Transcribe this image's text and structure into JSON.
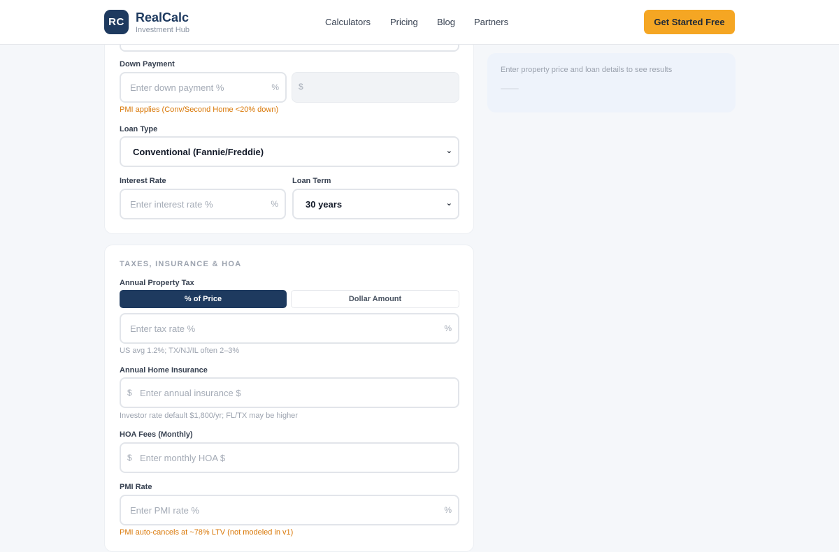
{
  "header": {
    "logo_mark": "RC",
    "brand": "RealCalc",
    "tagline": "Investment Hub",
    "nav": [
      "Calculators",
      "Pricing",
      "Blog",
      "Partners"
    ],
    "cta": "Get Started Free"
  },
  "loan": {
    "down_payment": {
      "label": "Down Payment",
      "percent_placeholder": "Enter down payment %",
      "percent_suffix": "%",
      "dollar_prefix": "$",
      "hint": "PMI applies (Conv/Second Home <20% down)"
    },
    "loan_type": {
      "label": "Loan Type",
      "selected": "Conventional (Fannie/Freddie)"
    },
    "interest_rate": {
      "label": "Interest Rate",
      "placeholder": "Enter interest rate %",
      "suffix": "%"
    },
    "loan_term": {
      "label": "Loan Term",
      "selected": "30 years"
    }
  },
  "taxes": {
    "section_title": "TAXES, INSURANCE & HOA",
    "property_tax": {
      "label": "Annual Property Tax",
      "toggle": [
        "% of Price",
        "Dollar Amount"
      ],
      "active_toggle": "% of Price",
      "placeholder": "Enter tax rate %",
      "suffix": "%",
      "hint": "US avg 1.2%; TX/NJ/IL often 2–3%"
    },
    "insurance": {
      "label": "Annual Home Insurance",
      "prefix": "$",
      "placeholder": "Enter annual insurance $",
      "hint": "Investor rate default $1,800/yr; FL/TX may be higher"
    },
    "hoa": {
      "label": "HOA Fees (Monthly)",
      "prefix": "$",
      "placeholder": "Enter monthly HOA $"
    },
    "pmi": {
      "label": "PMI Rate",
      "placeholder": "Enter PMI rate %",
      "suffix": "%",
      "hint": "PMI auto-cancels at ~78% LTV (not modeled in v1)"
    }
  },
  "results": {
    "empty_text": "Enter property price and loan details to see results"
  },
  "colors": {
    "brand_navy": "#1e3a5f",
    "accent_orange": "#f5a623",
    "warn_text": "#d97706"
  }
}
